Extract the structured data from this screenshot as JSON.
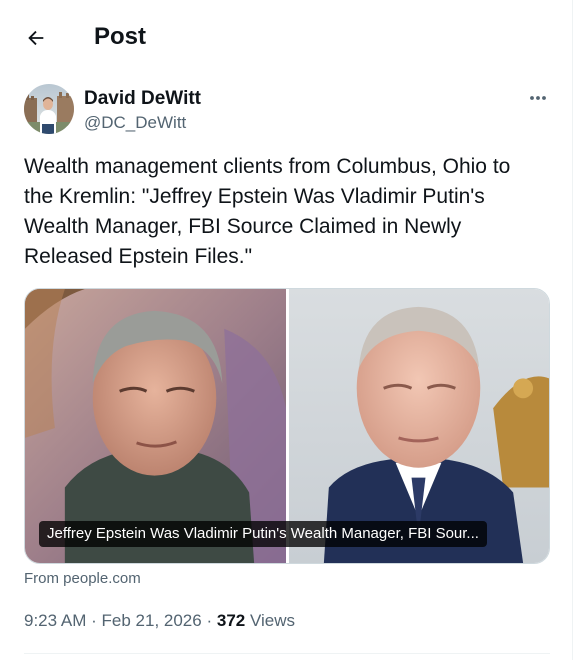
{
  "header": {
    "back_icon": "arrow-left-icon",
    "title": "Post"
  },
  "author": {
    "display_name": "David DeWitt",
    "handle": "@DC_DeWitt",
    "more_icon": "more-dots-icon"
  },
  "post": {
    "text": "Wealth management clients from Columbus, Ohio to the Kremlin: \"Jeffrey Epstein Was Vladimir Putin's Wealth Manager, FBI Source Claimed in Newly Released Epstein Files.\""
  },
  "link_card": {
    "caption": "Jeffrey Epstein Was Vladimir Putin's Wealth Manager, FBI Sour...",
    "source": "From people.com"
  },
  "meta": {
    "time": "9:23 AM",
    "separator": "·",
    "date": "Feb 21, 2026",
    "view_count": "372",
    "views_label": "Views"
  },
  "colors": {
    "text_primary": "#0f1419",
    "text_secondary": "#536471",
    "border": "#cfd9de"
  }
}
